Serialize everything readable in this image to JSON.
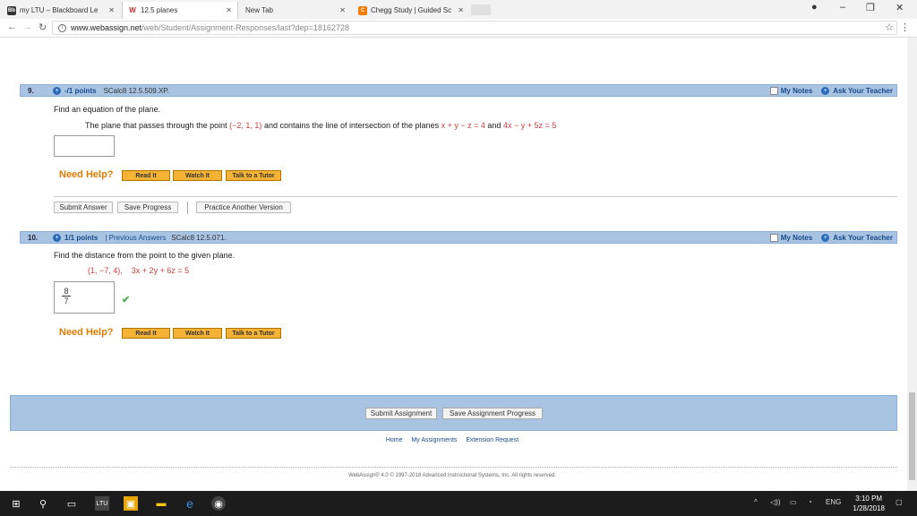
{
  "browser": {
    "tabs": [
      {
        "title": "my LTU – Blackboard Le",
        "active": false
      },
      {
        "title": "12.5 planes",
        "active": true
      },
      {
        "title": "New Tab",
        "active": false
      },
      {
        "title": "Chegg Study | Guided Sc",
        "active": false
      }
    ],
    "url_host": "www.webassign.net",
    "url_path": "/web/Student/Assignment-Responses/last?dep=18162728"
  },
  "q9": {
    "number": "9.",
    "points": "-/1 points",
    "source": "SCalc8 12.5.509.XP.",
    "my_notes": "My Notes",
    "ask_teacher": "Ask Your Teacher",
    "prompt": "Find an equation of the plane.",
    "text_pre": "The plane that passes through the point",
    "point": "(−2, 1, 1)",
    "text_mid": "and contains the line of intersection of the planes",
    "plane1": "x + y − z = 4",
    "text_and": "and",
    "plane2": "4x − y + 5z = 5",
    "need_help": "Need Help?",
    "read_it": "Read It",
    "watch_it": "Watch It",
    "talk_tutor": "Talk to a Tutor",
    "submit_answer": "Submit Answer",
    "save_progress": "Save Progress",
    "practice_version": "Practice Another Version"
  },
  "q10": {
    "number": "10.",
    "points": "1/1 points",
    "previous_answers": "| Previous Answers",
    "source": "SCalc8 12.5.071.",
    "my_notes": "My Notes",
    "ask_teacher": "Ask Your Teacher",
    "prompt": "Find the distance from the point to the given plane.",
    "point": "(1, −7, 4),",
    "plane": "3x + 2y + 6z = 5",
    "answer_num": "8",
    "answer_den": "7",
    "need_help": "Need Help?",
    "read_it": "Read It",
    "watch_it": "Watch It",
    "talk_tutor": "Talk to a Tutor"
  },
  "footer": {
    "submit_assignment": "Submit Assignment",
    "save_assignment_progress": "Save Assignment Progress",
    "links": [
      "Home",
      "My Assignments",
      "Extension Request"
    ],
    "copyright": "WebAssign® 4.0 © 1997-2018 Advanced Instructional Systems, Inc. All rights reserved."
  },
  "taskbar": {
    "lang": "ENG",
    "time": "3:10 PM",
    "date": "1/28/2018"
  }
}
